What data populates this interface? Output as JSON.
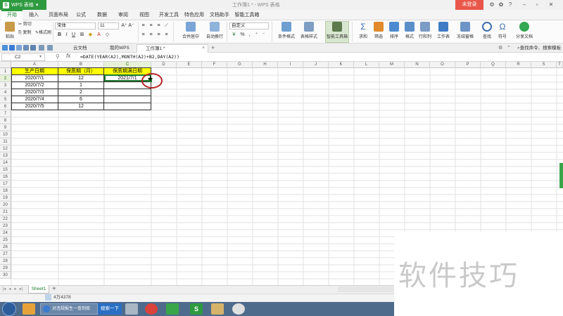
{
  "app": {
    "name": "WPS 表格",
    "doc_title": "工作簿1 * - WPS 表格",
    "login_label": "未登录",
    "window_controls": [
      "gear-icon",
      "skin-icon",
      "help-icon",
      "minimize-icon",
      "restore-icon",
      "close-icon"
    ]
  },
  "menu": {
    "tabs": [
      "开始",
      "插入",
      "页面布局",
      "公式",
      "数据",
      "审阅",
      "视图",
      "开发工具",
      "特色应用",
      "文档助手",
      "智能工具箱"
    ],
    "active": "开始"
  },
  "ribbon": {
    "paste": "粘贴",
    "cut": "剪切",
    "copy": "复制",
    "format_painter": "格式刷",
    "font_name": "宋体",
    "font_size": "11",
    "grow_font": "A⁺",
    "shrink_font": "A⁻",
    "bold": "B",
    "italic": "I",
    "underline": "U",
    "merge_center": "合并居中",
    "auto_wrap": "自动换行",
    "number_format": "自定义",
    "percent": "%",
    "thousands": ",",
    "cond_format": "条件格式",
    "table_style": "表格样式",
    "smart_toolbox": "智能工具箱",
    "sum": "求和",
    "filter": "筛选",
    "sort": "排序",
    "format": "格式",
    "row_col": "行和列",
    "worksheet": "工作表",
    "freeze": "冻结窗格",
    "find": "查找",
    "symbol": "符号",
    "share": "分享文档"
  },
  "doc_tabs": {
    "items": [
      "云文档",
      "我的WPS",
      "工作簿1 *"
    ],
    "active": "工作簿1 *",
    "add": "+",
    "search_cmd": "查找命令、搜索模板"
  },
  "formula_bar": {
    "cell_ref": "C2",
    "fx": "fx",
    "formula": "=DATE(YEAR(A2),MONTH(A2)+B2,DAY(A2))"
  },
  "grid": {
    "columns": [
      "A",
      "B",
      "C",
      "D",
      "E",
      "F",
      "G",
      "H",
      "I",
      "J",
      "K",
      "L",
      "M",
      "N",
      "O",
      "P",
      "Q",
      "R",
      "S",
      "T"
    ],
    "selected_col": "C",
    "rows": [
      "1",
      "2",
      "3",
      "4",
      "5",
      "6",
      "7",
      "8",
      "9",
      "10",
      "11",
      "12",
      "13",
      "14",
      "15",
      "16",
      "17",
      "18",
      "19",
      "20",
      "21",
      "22",
      "23",
      "24",
      "25",
      "26",
      "27",
      "28",
      "29",
      "30",
      "31"
    ],
    "selected_row": "2",
    "headers": [
      "生产日期",
      "保质期（月）",
      "保质期满日期"
    ],
    "data": [
      [
        "2020/7/1",
        "12",
        "2021/7/1"
      ],
      [
        "2020/7/2",
        "1",
        ""
      ],
      [
        "2020/7/3",
        "2",
        ""
      ],
      [
        "2020/7/4",
        "6",
        ""
      ],
      [
        "2020/7/5",
        "12",
        ""
      ]
    ],
    "cursor": "+"
  },
  "sheets": {
    "tabs": [
      "Sheet1"
    ],
    "add": "+"
  },
  "status": {
    "text": "4万4378"
  },
  "taskbar": {
    "ie_item": "对违规报生一查到底",
    "search_item": "搜索一下"
  },
  "watermark": "软件技巧",
  "colors": {
    "brand_green": "#2e9a3f",
    "header_fill": "#ffff00",
    "selection": "#1e7a2e",
    "annotation_red": "#b72222",
    "login_red": "#e9574a"
  }
}
